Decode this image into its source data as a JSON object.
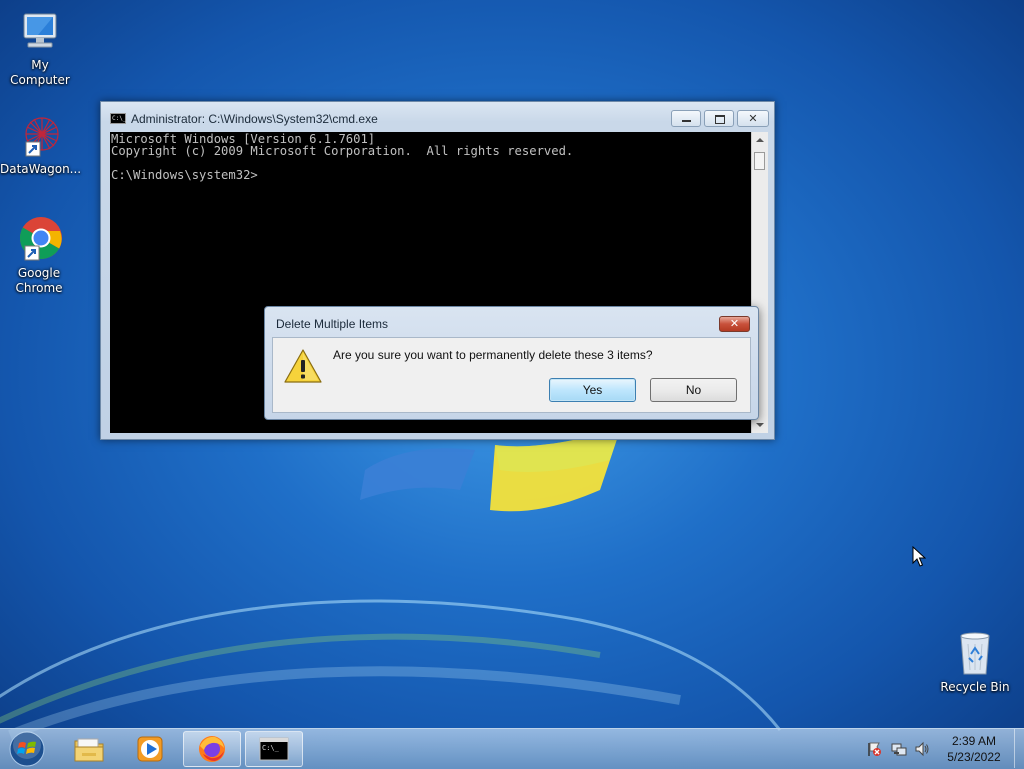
{
  "desktop": {
    "icons": [
      {
        "label": "My Computer",
        "icon": "computer-icon"
      },
      {
        "label": "DataWagon...",
        "icon": "datawagon-icon"
      },
      {
        "label": "Google\nChrome",
        "label_line1": "Google",
        "label_line2": "Chrome",
        "icon": "chrome-icon"
      },
      {
        "label": "Recycle Bin",
        "icon": "recycle-bin-icon"
      }
    ]
  },
  "cmd": {
    "title": "Administrator: C:\\Windows\\System32\\cmd.exe",
    "icon_text": "C:\\_",
    "lines": [
      "Microsoft Windows [Version 6.1.7601]",
      "Copyright (c) 2009 Microsoft Corporation.  All rights reserved.",
      "",
      "C:\\Windows\\system32>"
    ]
  },
  "dialog": {
    "title": "Delete Multiple Items",
    "message": "Are you sure you want to permanently delete these 3 items?",
    "yes_label": "Yes",
    "no_label": "No",
    "close_label": "✕"
  },
  "taskbar": {
    "items": [
      "start-orb-icon",
      "file-explorer-icon",
      "media-player-icon",
      "firefox-icon",
      "cmd-icon"
    ],
    "clock": {
      "time": "2:39 AM",
      "date": "5/23/2022"
    }
  },
  "colors": {
    "wallpaper_blue": "#1f6fc8",
    "console_bg": "#000000",
    "console_fg": "#c0c0c0",
    "close_red": "#c8513b"
  }
}
